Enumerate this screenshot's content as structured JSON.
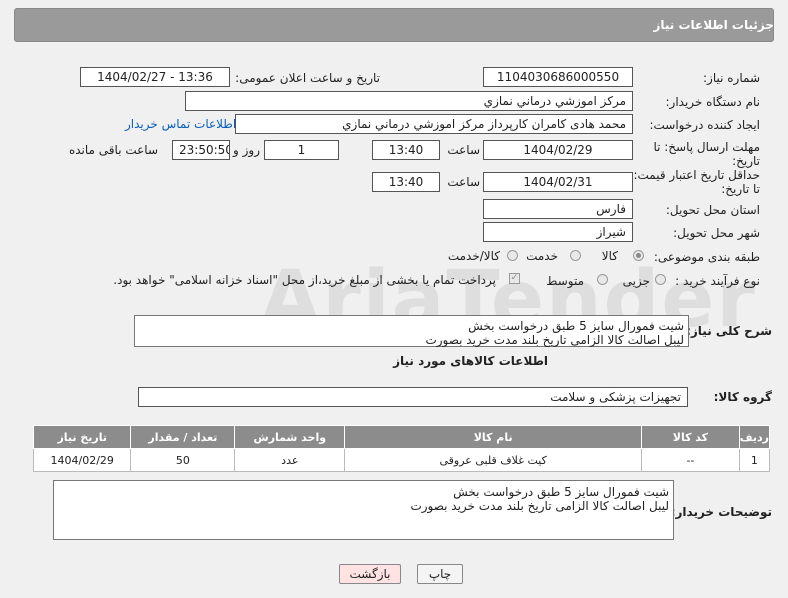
{
  "header": {
    "title": "جزئیات اطلاعات نیاز"
  },
  "fields": {
    "need_number_label": "شماره نیاز:",
    "need_number": "1104030686000550",
    "announce_label": "تاریخ و ساعت اعلان عمومی:",
    "announce_value": "1404/02/27 - 13:36",
    "buyer_org_label": "نام دستگاه خریدار:",
    "buyer_org": "مرکز اموزشي درماني نمازي",
    "creator_label": "ایجاد کننده درخواست:",
    "creator": "محمد هادی کامران کارپرداز مرکز اموزشي درماني نمازي",
    "contact_link": "اطلاعات تماس خریدار",
    "deadline_label_1": "مهلت ارسال پاسخ: تا",
    "deadline_label_2": "تاریخ:",
    "deadline_date": "1404/02/29",
    "time_label": "ساعت",
    "deadline_time": "13:40",
    "days_value": "1",
    "days_label": "روز و",
    "remaining_time": "23:50:50",
    "remaining_label": "ساعت باقی مانده",
    "price_label_1": "حداقل تاریخ اعتبار قیمت:",
    "price_label_2": "تا تاریخ:",
    "price_date": "1404/02/31",
    "price_time": "13:40",
    "province_label": "استان محل تحویل:",
    "province": "فارس",
    "city_label": "شهر محل تحویل:",
    "city": "شیراز",
    "category_label": "طبقه بندی موضوعی:",
    "category_options": [
      "کالا",
      "خدمت",
      "کالا/خدمت"
    ],
    "process_label": "نوع فرآیند خرید :",
    "process_options": [
      "جزیی",
      "متوسط"
    ],
    "payment_note": "پرداخت تمام یا بخشی از مبلغ خرید،از محل \"اسناد خزانه اسلامی\" خواهد بود."
  },
  "summary": {
    "label": "شرح کلی نیاز:",
    "line1": "شیت فمورال سایز 5 طبق درخواست بخش",
    "line2": "لیبل اصالت کالا الزامی تاریخ بلند مدت خرید بصورت"
  },
  "goods_info_title": "اطلاعات کالاهای مورد نیاز",
  "goods_group": {
    "label": "گروه کالا:",
    "value": "تجهیزات پزشکی و سلامت"
  },
  "table": {
    "headers": [
      "ردیف",
      "کد کالا",
      "نام کالا",
      "واحد شمارش",
      "تعداد / مقدار",
      "تاریخ نیاز"
    ],
    "rows": [
      [
        "1",
        "--",
        "کیت غلاف قلبی عروقی",
        "عدد",
        "50",
        "1404/02/29"
      ]
    ]
  },
  "buyer_notes": {
    "label": "توضیحات خریدار:",
    "line1": "شیت فمورال سایز 5 طبق درخواست بخش",
    "line2": "لیبل اصالت کالا الزامی تاریخ بلند مدت خرید بصورت"
  },
  "buttons": {
    "print": "چاپ",
    "back": "بازگشت"
  }
}
